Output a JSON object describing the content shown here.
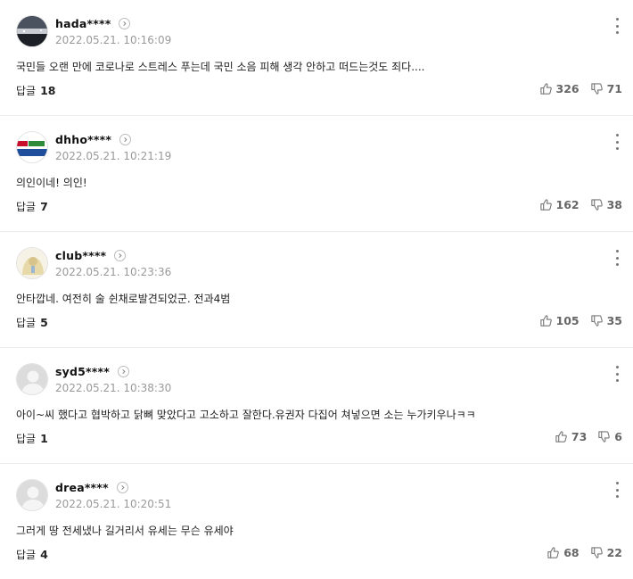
{
  "comments": [
    {
      "nickname": "hada****",
      "date": "2022.05.21. 10:16:09",
      "text": "국민들 오랜 만에 코로나로 스트레스 푸는데 국민 소음 피해 생각 안하고 떠드는것도 죄다....",
      "reply_label": "답글",
      "reply_count": "18",
      "likes": "326",
      "dislikes": "71",
      "avatar": "night-scene-photo"
    },
    {
      "nickname": "dhho****",
      "date": "2022.05.21. 10:21:19",
      "text": "의인이네! 의인!",
      "reply_label": "답글",
      "reply_count": "7",
      "likes": "162",
      "dislikes": "38",
      "avatar": "logo-image"
    },
    {
      "nickname": "club****",
      "date": "2022.05.21. 10:23:36",
      "text": "안타깝네. 여전히 술 쉰채로발견되었군. 전과4범",
      "reply_label": "답글",
      "reply_count": "5",
      "likes": "105",
      "dislikes": "35",
      "avatar": "illustration-image"
    },
    {
      "nickname": "syd5****",
      "date": "2022.05.21. 10:38:30",
      "text": "아이~씨 했다고 협박하고 닭뼈 맞았다고 고소하고 잘한다.유권자 다집어 쳐넣으면 소는 누가키우나ㅋㅋ",
      "reply_label": "답글",
      "reply_count": "1",
      "likes": "73",
      "dislikes": "6",
      "avatar": "default-profile"
    },
    {
      "nickname": "drea****",
      "date": "2022.05.21. 10:20:51",
      "text": "그러게 땅 전세냈나 길거리서 유세는 무슨 유세야",
      "reply_label": "답글",
      "reply_count": "4",
      "likes": "68",
      "dislikes": "22",
      "avatar": "default-profile"
    }
  ]
}
